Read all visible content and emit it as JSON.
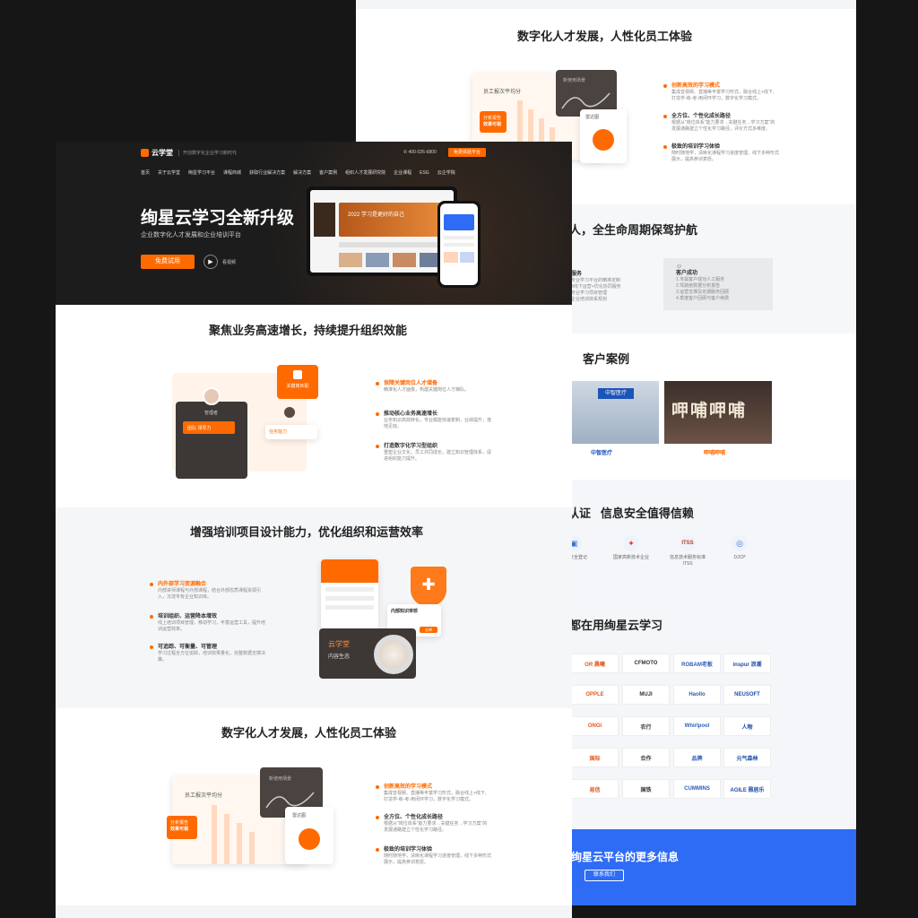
{
  "back": {
    "section1_title": "数字化人才发展，人性化员工体验",
    "features": [
      {
        "title": "创新高效的学习模式",
        "desc": "集成音视频、直播等丰富学习形式，融合线上+线下、打造学-练-考-用闭环学习，数字化学习模式。"
      },
      {
        "title": "全方位、个性化成长路径",
        "desc": "根据从\"岗位体系\"能力要求→关键任务→学习方案\"的发展通路建立个性化学习路径，评价方式多维度。"
      },
      {
        "title": "极致的培训学习体验",
        "desc": "随时随地学，清晰化课程学习进度管理，线下多种形式展示，提高参训意愿。"
      }
    ],
    "mock_label_1": "员工报次平均分",
    "mock_label_2": "新使用场景",
    "mock_label_3": "雷达图",
    "mock_badge": "分析报告",
    "mock_badge2": "效果可视",
    "section2_title": "人，全生命周期保驾护航",
    "service_left_title": "服务",
    "service_left_items": [
      "专业学习平台的精准定制",
      "3线下运营+优化协同服务",
      "专业学习项目管理",
      "企业培训体系规划"
    ],
    "service_right_title": "客户成功",
    "service_right_items": [
      "1.专属客户成功人工服务",
      "2.驾驶舱数据分析报告",
      "3.运营支撑及定期服务回顾",
      "4.季度客户回顾与客户续费"
    ],
    "section3_title": "客户案例",
    "case1_name": "中智医疗",
    "case2_name": "呷哺呷哺",
    "case1_sign": "中智医疗",
    "case2_sign": "呷哺呷哺",
    "section4_title": "认证   信息安全值得信赖",
    "certs": [
      {
        "icon": "▣",
        "label": "系统安全登记"
      },
      {
        "icon": "✦",
        "label": "国家高新技术企业"
      },
      {
        "icon": "ITSS",
        "label": "信息技术服务标准 ITSS"
      },
      {
        "icon": "◎",
        "label": "DJCP"
      }
    ],
    "section5_title": "都在用绚星云学习",
    "logos": [
      [
        "OR 晨曦",
        "CFMOTO",
        "ROBAM老板",
        "inspur 浪潮"
      ],
      [
        "OPPLE",
        "MUJI",
        "Haollo",
        "NEUSOFT"
      ],
      [
        "ONGI",
        "农行",
        "Whirlpool",
        "人物"
      ],
      [
        "国际",
        "合作",
        "品牌",
        "元气森林"
      ],
      [
        "易信",
        "国铁",
        "CUMMINS",
        "AGILE 雅居乐"
      ]
    ],
    "banner_title": "绚星云平台的更多信息",
    "banner_button": "联系我们"
  },
  "front": {
    "brand": "云学堂",
    "slogan": "开创数字化企业学习新时代",
    "phone": "400-026-6800",
    "header_button": "免费体验平台",
    "nav": [
      "首页",
      "关于云学堂",
      "绚星学习平台",
      "课程商城",
      "获取行业解决方案",
      "解决方案",
      "客户案例",
      "组织人才发展研究院",
      "企业课程",
      "ESG",
      "云企学院"
    ],
    "hero_title": "绚星云学习全新升级",
    "hero_subtitle": "企业数字化人才发展和企业培训平台",
    "hero_button": "免费试用",
    "hero_video": "看视频",
    "tablet_text": "2022 学习是更好的自己",
    "s1_title": "聚焦业务高速增长，持续提升组织效能",
    "s1_card_label": "关键岗匹配",
    "s1_name": "管理者",
    "s1_tag1": "团队 领导力",
    "s1_tag2": "任务能力",
    "s1_features": [
      {
        "title": "保障关键岗位人才储备",
        "desc": "精准化人才画像，构建关键岗位人才梯队。"
      },
      {
        "title": "推动核心业务高速增长",
        "desc": "业务知识高效转化，专业赋能快速复制，业绩提升，落地见效。"
      },
      {
        "title": "打造数字化学习型组织",
        "desc": "重塑企业文化，员工共同成长，建立知识管理体系，促进组织能力提升。"
      }
    ],
    "s2_title": "增强培训项目设计能力，优化组织和运营效率",
    "s2_features": [
      {
        "title": "内外部学习资源融合",
        "desc": "内部讲师课程与外部课程，结合外部优质课程资源引入，沉淀专有企业知识库。"
      },
      {
        "title": "培训组织、运营降本增效",
        "desc": "线上培训项目管理，移动学习，丰富运营工具，提升培训运营效率。"
      },
      {
        "title": "可追踪、可衡量、可管理",
        "desc": "学习过程全方位追踪，培训效果量化，完整数据支撑决策。"
      }
    ],
    "s2_card_title": "云学堂",
    "s2_card_sub": "内容生态",
    "s2_dialog": "内部知识审核",
    "s2_dialog_btn": "去审",
    "s3_title": "数字化人才发展，人性化员工体验",
    "s3_features": [
      {
        "title": "创新高效的学习模式",
        "desc": "集成音视频、直播等丰富学习形式，融合线上+线下、打造学-练-考-用闭环学习，数字化学习模式。"
      },
      {
        "title": "全方位、个性化成长路径",
        "desc": "根据从\"岗位体系\"能力要求→关键任务→学习方案\"的发展通路建立个性化学习路径。"
      },
      {
        "title": "极致的培训学习体验",
        "desc": "随时随地学，清晰化课程学习进度管理，线下多种形式展示，提高参训意愿。"
      }
    ],
    "s3_label_1": "员工报次平均分",
    "s3_label_2": "新使用场景",
    "s3_label_3": "雷达图",
    "s3_badge": "分析报告",
    "s3_badge2": "效果可视"
  },
  "colors": {
    "accent": "#ff6a00",
    "dark": "#1c1c1c",
    "blue": "#2f6cf6"
  }
}
